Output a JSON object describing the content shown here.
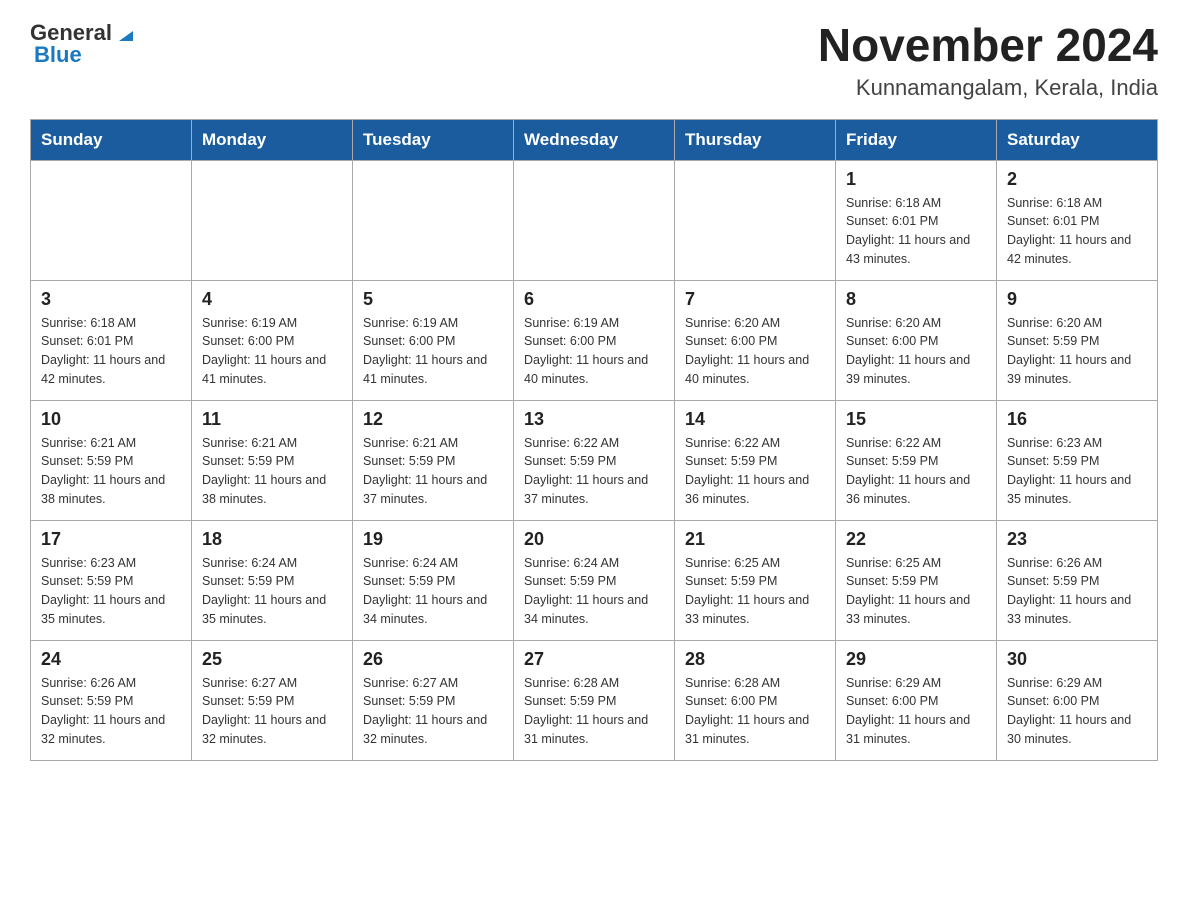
{
  "header": {
    "logo": {
      "general": "General",
      "blue": "Blue"
    },
    "title": "November 2024",
    "location": "Kunnamangalam, Kerala, India"
  },
  "weekdays": [
    "Sunday",
    "Monday",
    "Tuesday",
    "Wednesday",
    "Thursday",
    "Friday",
    "Saturday"
  ],
  "weeks": [
    [
      {
        "day": "",
        "info": ""
      },
      {
        "day": "",
        "info": ""
      },
      {
        "day": "",
        "info": ""
      },
      {
        "day": "",
        "info": ""
      },
      {
        "day": "",
        "info": ""
      },
      {
        "day": "1",
        "info": "Sunrise: 6:18 AM\nSunset: 6:01 PM\nDaylight: 11 hours and 43 minutes."
      },
      {
        "day": "2",
        "info": "Sunrise: 6:18 AM\nSunset: 6:01 PM\nDaylight: 11 hours and 42 minutes."
      }
    ],
    [
      {
        "day": "3",
        "info": "Sunrise: 6:18 AM\nSunset: 6:01 PM\nDaylight: 11 hours and 42 minutes."
      },
      {
        "day": "4",
        "info": "Sunrise: 6:19 AM\nSunset: 6:00 PM\nDaylight: 11 hours and 41 minutes."
      },
      {
        "day": "5",
        "info": "Sunrise: 6:19 AM\nSunset: 6:00 PM\nDaylight: 11 hours and 41 minutes."
      },
      {
        "day": "6",
        "info": "Sunrise: 6:19 AM\nSunset: 6:00 PM\nDaylight: 11 hours and 40 minutes."
      },
      {
        "day": "7",
        "info": "Sunrise: 6:20 AM\nSunset: 6:00 PM\nDaylight: 11 hours and 40 minutes."
      },
      {
        "day": "8",
        "info": "Sunrise: 6:20 AM\nSunset: 6:00 PM\nDaylight: 11 hours and 39 minutes."
      },
      {
        "day": "9",
        "info": "Sunrise: 6:20 AM\nSunset: 5:59 PM\nDaylight: 11 hours and 39 minutes."
      }
    ],
    [
      {
        "day": "10",
        "info": "Sunrise: 6:21 AM\nSunset: 5:59 PM\nDaylight: 11 hours and 38 minutes."
      },
      {
        "day": "11",
        "info": "Sunrise: 6:21 AM\nSunset: 5:59 PM\nDaylight: 11 hours and 38 minutes."
      },
      {
        "day": "12",
        "info": "Sunrise: 6:21 AM\nSunset: 5:59 PM\nDaylight: 11 hours and 37 minutes."
      },
      {
        "day": "13",
        "info": "Sunrise: 6:22 AM\nSunset: 5:59 PM\nDaylight: 11 hours and 37 minutes."
      },
      {
        "day": "14",
        "info": "Sunrise: 6:22 AM\nSunset: 5:59 PM\nDaylight: 11 hours and 36 minutes."
      },
      {
        "day": "15",
        "info": "Sunrise: 6:22 AM\nSunset: 5:59 PM\nDaylight: 11 hours and 36 minutes."
      },
      {
        "day": "16",
        "info": "Sunrise: 6:23 AM\nSunset: 5:59 PM\nDaylight: 11 hours and 35 minutes."
      }
    ],
    [
      {
        "day": "17",
        "info": "Sunrise: 6:23 AM\nSunset: 5:59 PM\nDaylight: 11 hours and 35 minutes."
      },
      {
        "day": "18",
        "info": "Sunrise: 6:24 AM\nSunset: 5:59 PM\nDaylight: 11 hours and 35 minutes."
      },
      {
        "day": "19",
        "info": "Sunrise: 6:24 AM\nSunset: 5:59 PM\nDaylight: 11 hours and 34 minutes."
      },
      {
        "day": "20",
        "info": "Sunrise: 6:24 AM\nSunset: 5:59 PM\nDaylight: 11 hours and 34 minutes."
      },
      {
        "day": "21",
        "info": "Sunrise: 6:25 AM\nSunset: 5:59 PM\nDaylight: 11 hours and 33 minutes."
      },
      {
        "day": "22",
        "info": "Sunrise: 6:25 AM\nSunset: 5:59 PM\nDaylight: 11 hours and 33 minutes."
      },
      {
        "day": "23",
        "info": "Sunrise: 6:26 AM\nSunset: 5:59 PM\nDaylight: 11 hours and 33 minutes."
      }
    ],
    [
      {
        "day": "24",
        "info": "Sunrise: 6:26 AM\nSunset: 5:59 PM\nDaylight: 11 hours and 32 minutes."
      },
      {
        "day": "25",
        "info": "Sunrise: 6:27 AM\nSunset: 5:59 PM\nDaylight: 11 hours and 32 minutes."
      },
      {
        "day": "26",
        "info": "Sunrise: 6:27 AM\nSunset: 5:59 PM\nDaylight: 11 hours and 32 minutes."
      },
      {
        "day": "27",
        "info": "Sunrise: 6:28 AM\nSunset: 5:59 PM\nDaylight: 11 hours and 31 minutes."
      },
      {
        "day": "28",
        "info": "Sunrise: 6:28 AM\nSunset: 6:00 PM\nDaylight: 11 hours and 31 minutes."
      },
      {
        "day": "29",
        "info": "Sunrise: 6:29 AM\nSunset: 6:00 PM\nDaylight: 11 hours and 31 minutes."
      },
      {
        "day": "30",
        "info": "Sunrise: 6:29 AM\nSunset: 6:00 PM\nDaylight: 11 hours and 30 minutes."
      }
    ]
  ]
}
